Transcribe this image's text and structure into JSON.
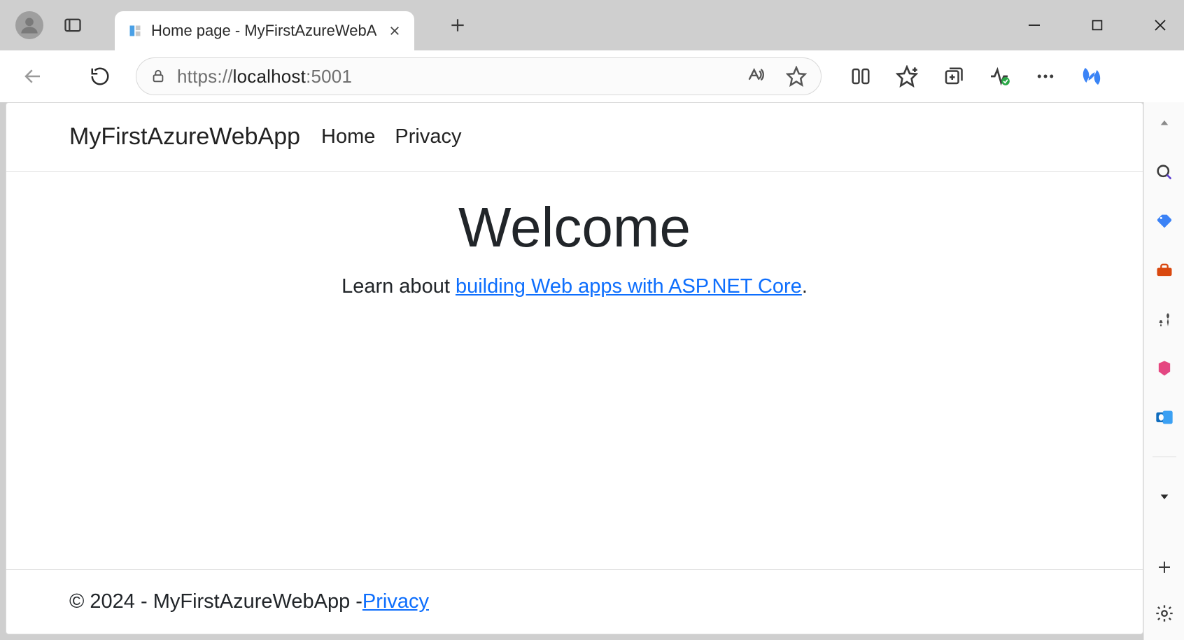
{
  "browser": {
    "tab_title": "Home page - MyFirstAzureWebA",
    "window_controls": {
      "minimize": "minimize",
      "maximize": "maximize",
      "close": "close"
    }
  },
  "addressbar": {
    "scheme": "https://",
    "host": "localhost",
    "port_suffix": ":5001"
  },
  "page": {
    "brand": "MyFirstAzureWebApp",
    "nav": {
      "home": "Home",
      "privacy": "Privacy"
    },
    "main": {
      "heading": "Welcome",
      "lead_prefix": "Learn about ",
      "lead_link": "building Web apps with ASP.NET Core",
      "lead_suffix": "."
    },
    "footer": {
      "text": "© 2024 - MyFirstAzureWebApp - ",
      "privacy_link": "Privacy"
    }
  }
}
